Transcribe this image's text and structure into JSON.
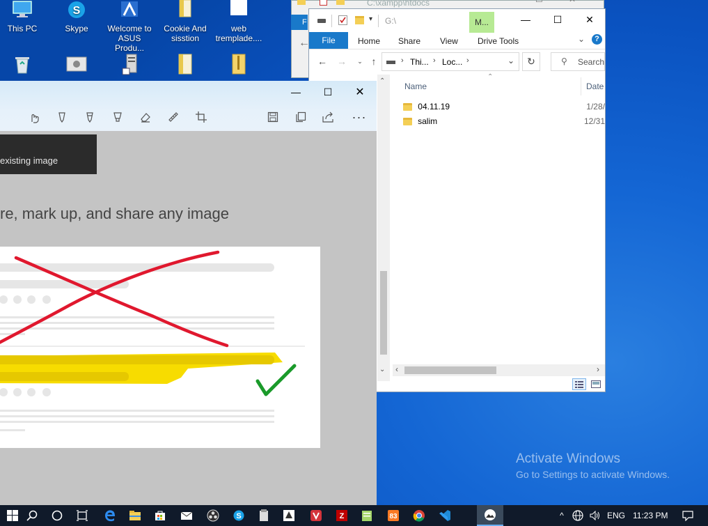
{
  "desktop": {
    "icons": [
      {
        "label": "This PC"
      },
      {
        "label": "Skype"
      },
      {
        "label": "Welcome to ASUS Produ..."
      },
      {
        "label": "Cookie And sisstion"
      },
      {
        "label": "web tremplade...."
      }
    ]
  },
  "explorer_back": {
    "path": "C:\\xampp\\htdocs"
  },
  "explorer": {
    "title": "G:\\",
    "manage_label": "M...",
    "tabs": {
      "file": "File",
      "home": "Home",
      "share": "Share",
      "view": "View",
      "drive_tools": "Drive Tools"
    },
    "breadcrumb": [
      "Thi...",
      "Loc..."
    ],
    "search_placeholder": "Search",
    "columns": {
      "name": "Name",
      "date": "Date"
    },
    "files": [
      {
        "name": "04.11.19",
        "date": "1/28/"
      },
      {
        "name": "salim",
        "date": "12/31"
      }
    ]
  },
  "snip": {
    "banner_text": "existing image",
    "headline": "re, mark up, and share any image"
  },
  "watermark": {
    "title": "Activate Windows",
    "subtitle": "Go to Settings to activate Windows."
  },
  "taskbar": {
    "language": "ENG",
    "time": "11:23 PM"
  },
  "colors": {
    "accent": "#0a72c4",
    "desktop": "#1466d4",
    "taskbar": "#101a2a",
    "red_mark": "#e0182e",
    "yellow_mark": "#f5d800",
    "green_check": "#1a9a2a"
  }
}
